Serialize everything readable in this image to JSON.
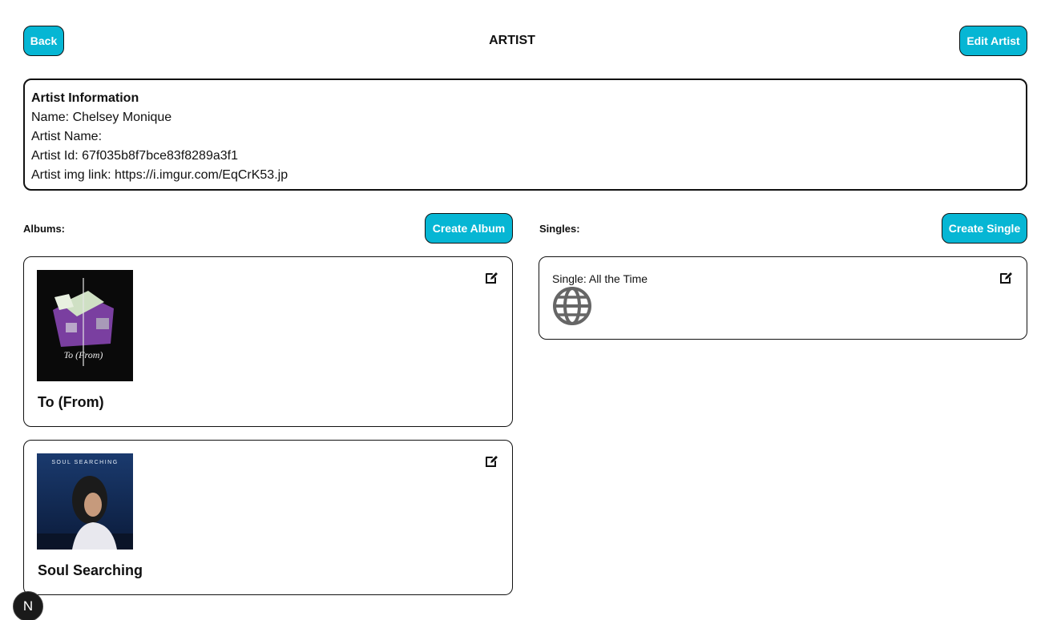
{
  "header": {
    "back_label": "Back",
    "title": "ARTIST",
    "edit_label": "Edit Artist"
  },
  "artist_info": {
    "heading": "Artist Information",
    "name_line": "Name: Chelsey Monique",
    "artist_name_line": "Artist Name:",
    "artist_id_line": "Artist Id: 67f035b8f7bce83f8289a3f1",
    "img_link_line": "Artist img link: https://i.imgur.com/EqCrK53.jp"
  },
  "albums": {
    "label": "Albums:",
    "create_label": "Create Album",
    "items": [
      {
        "title": "To (From)",
        "cover_text": "To (From)",
        "icon": "edit-icon"
      },
      {
        "title": "Soul Searching",
        "cover_text": "SOUL SEARCHING",
        "icon": "edit-icon"
      }
    ]
  },
  "singles": {
    "label": "Singles:",
    "create_label": "Create Single",
    "items": [
      {
        "title": "Single: All the Time",
        "icon": "globe-icon"
      }
    ]
  },
  "dev_badge": {
    "letter": "N"
  },
  "colors": {
    "accent": "#06b6d4",
    "text": "#111111",
    "border": "#111111"
  }
}
